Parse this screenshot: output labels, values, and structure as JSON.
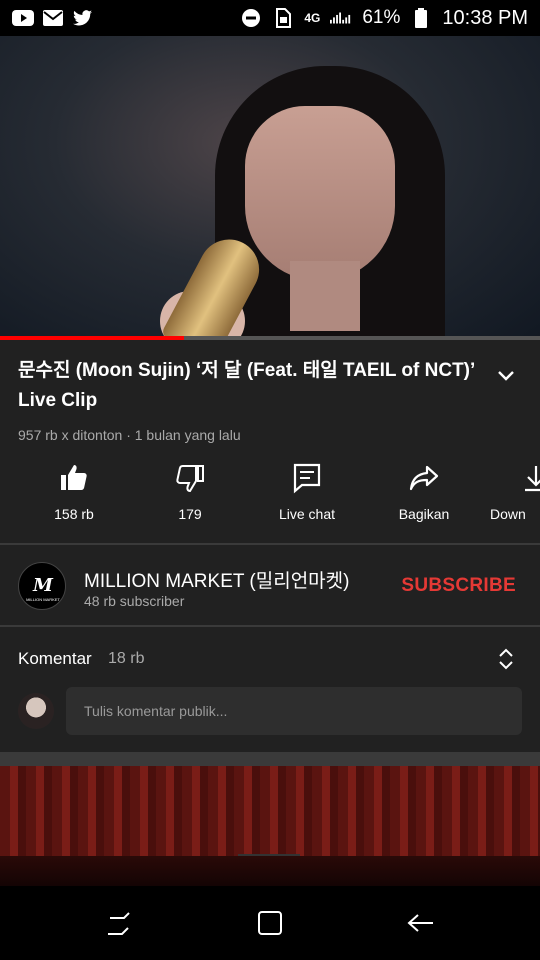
{
  "status_bar": {
    "network": "4G",
    "battery": "61%",
    "time": "10:38 PM",
    "icons": [
      "youtube-icon",
      "gmail-icon",
      "twitter-icon",
      "do-not-disturb-icon",
      "sim-icon",
      "signal-icon",
      "battery-icon"
    ]
  },
  "video": {
    "title": "문수진 (Moon Sujin) ‘저 달 (Feat. 태일 TAEIL of NCT)’ Live Clip",
    "views": "957 rb x ditonton",
    "age": "1 bulan yang lalu",
    "meta_separator": "·",
    "progress": 0.34,
    "progress_color": "#ff0000"
  },
  "actions": [
    {
      "label": "158 rb",
      "icon": "thumbs-up-icon"
    },
    {
      "label": "179",
      "icon": "thumbs-down-icon"
    },
    {
      "label": "Live chat",
      "icon": "chat-icon"
    },
    {
      "label": "Bagikan",
      "icon": "share-icon"
    },
    {
      "label": "Down",
      "icon": "download-icon"
    }
  ],
  "channel": {
    "name": "MILLION MARKET (밀리언마켓)",
    "subscribers": "48 rb subscriber",
    "subscribe_label": "SUBSCRIBE",
    "subscribe_color": "#e53935",
    "logo_text": "MILLION MARKET"
  },
  "comments": {
    "title": "Komentar",
    "count": "18 rb",
    "placeholder": "Tulis komentar publik..."
  },
  "nav": [
    "recent-apps-icon",
    "home-icon",
    "back-icon"
  ]
}
